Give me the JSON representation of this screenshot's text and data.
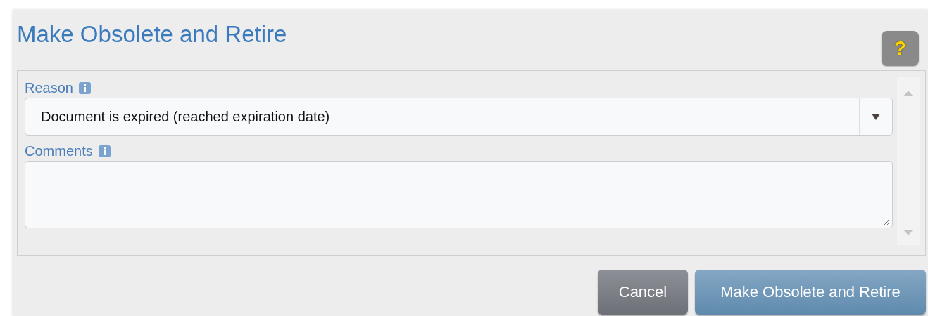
{
  "title": "Make Obsolete and Retire",
  "help_button": {
    "label": "?"
  },
  "fields": [
    {
      "kind": "select",
      "label": "Reason",
      "value": "Document is expired (reached expiration date)"
    },
    {
      "kind": "textarea",
      "label": "Comments"
    }
  ],
  "buttons": [
    {
      "kind": "secondary",
      "label": "Cancel"
    },
    {
      "kind": "primary",
      "label": "Make Obsolete and Retire"
    }
  ]
}
